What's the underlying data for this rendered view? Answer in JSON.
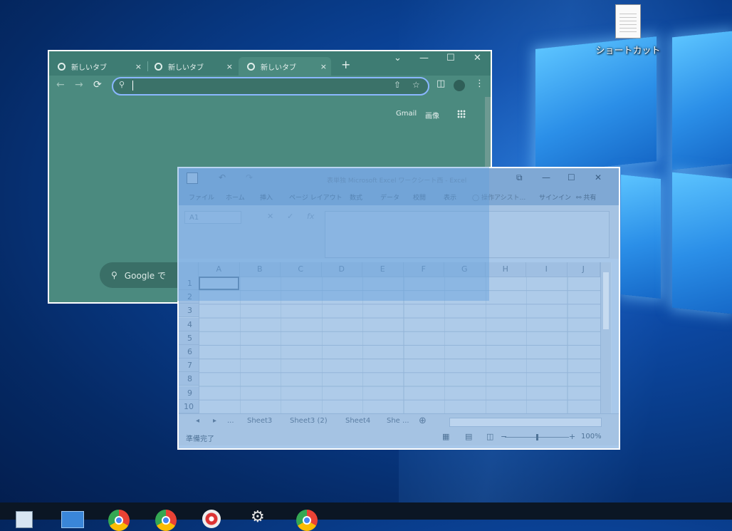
{
  "desktop": {
    "icon_label": "ショートカット",
    "icon_name": "document-shortcut-icon"
  },
  "chrome": {
    "tabs": [
      {
        "label": "新しいタブ",
        "close": "×"
      },
      {
        "label": "新しいタブ",
        "close": "×"
      },
      {
        "label": "新しいタブ",
        "close": "×"
      }
    ],
    "new_tab": "+",
    "window_controls": {
      "dropdown": "⌄",
      "minimize": "—",
      "maximize": "☐",
      "close": "✕"
    },
    "nav": {
      "back": "←",
      "forward": "→",
      "reload": "⟳"
    },
    "omnibox": {
      "value": "",
      "placeholder": ""
    },
    "google_links": {
      "gmail": "Gmail",
      "images": "画像"
    },
    "search_box_text": "Google で"
  },
  "excel": {
    "title": "表単独 Microsoft Excel ワークシート西 - Excel",
    "qat": {
      "undo": "↶",
      "redo": "↷"
    },
    "window_controls": {
      "restore": "⧉",
      "minimize": "—",
      "maximize": "☐",
      "close": "✕"
    },
    "ribbon_tabs": [
      "ファイル",
      "ホーム",
      "挿入",
      "ページ レイアウト",
      "数式",
      "データ",
      "校閲",
      "表示"
    ],
    "tell_me": "操作アシスト...",
    "signin": "サインイン",
    "share": "共有",
    "name_box": "A1",
    "formula_buttons": {
      "cancel": "✕",
      "enter": "✓",
      "fx": "fx"
    },
    "columns": [
      "A",
      "B",
      "C",
      "D",
      "E",
      "F",
      "G",
      "H",
      "I",
      "J"
    ],
    "rows": [
      "1",
      "2",
      "3",
      "4",
      "5",
      "6",
      "7",
      "8",
      "9",
      "10"
    ],
    "sheet_tabs": [
      "Sheet3",
      "Sheet3 (2)",
      "Sheet4",
      "She ..."
    ],
    "sheet_nav": {
      "prev": "◂",
      "next": "▸",
      "more": "..."
    },
    "add_sheet": "⊕",
    "status": "準備完了",
    "zoom": "100%",
    "zoom_minus": "−",
    "zoom_plus": "+"
  },
  "taskbar": {
    "icons": [
      "file-explorer-icon",
      "window-icon",
      "chrome-icon",
      "chrome-icon",
      "media-disc-icon",
      "settings-icon",
      "chrome-icon"
    ]
  }
}
